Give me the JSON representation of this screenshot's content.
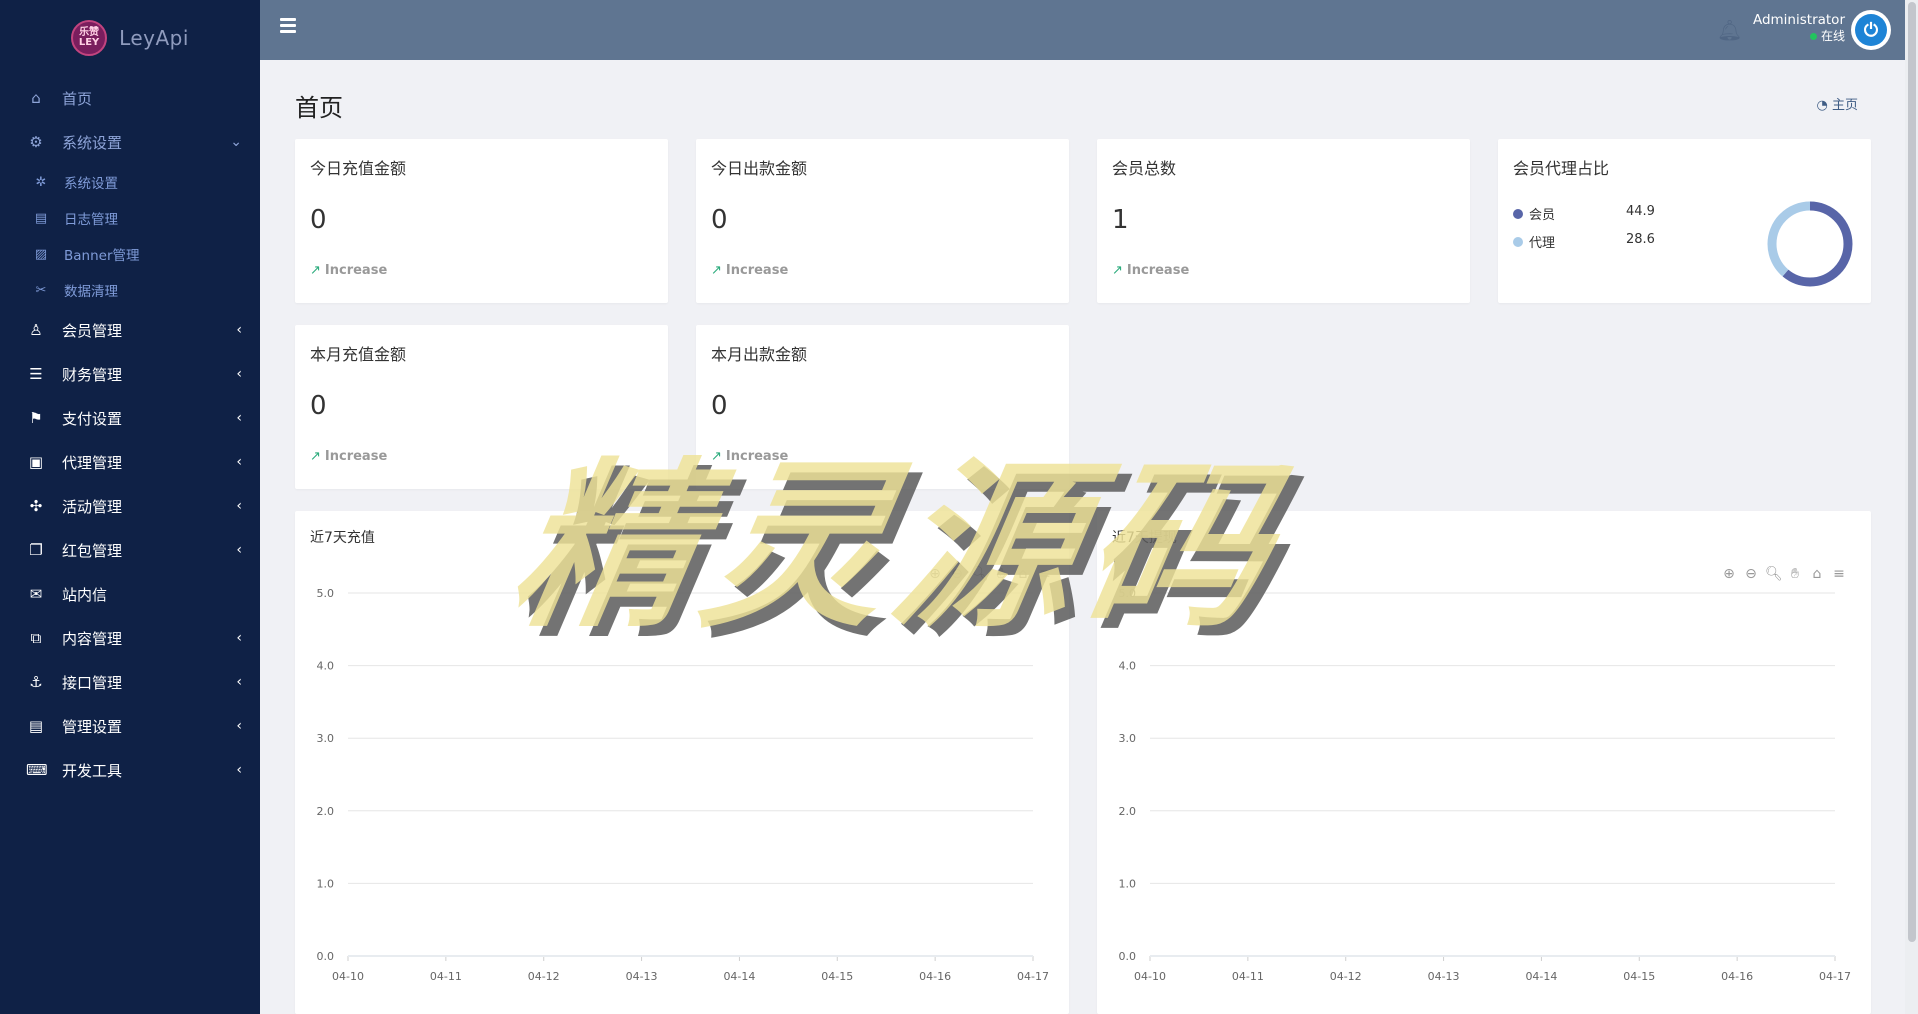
{
  "brand": {
    "logo_text": "乐赞LEY",
    "name": "LeyApi"
  },
  "header": {
    "user_name": "Administrator",
    "user_status": "在线"
  },
  "sidebar": {
    "items": [
      {
        "label": "首页",
        "icon": "home-icon"
      },
      {
        "label": "系统设置",
        "icon": "gears-icon",
        "expanded": true
      },
      {
        "label": "会员管理",
        "icon": "user-icon"
      },
      {
        "label": "财务管理",
        "icon": "database-icon"
      },
      {
        "label": "支付设置",
        "icon": "bookmark-icon"
      },
      {
        "label": "代理管理",
        "icon": "contact-icon"
      },
      {
        "label": "活动管理",
        "icon": "pinwheel-icon"
      },
      {
        "label": "红包管理",
        "icon": "clone-icon"
      },
      {
        "label": "站内信",
        "icon": "envelope-icon"
      },
      {
        "label": "内容管理",
        "icon": "copy-icon"
      },
      {
        "label": "接口管理",
        "icon": "anchor-icon"
      },
      {
        "label": "管理设置",
        "icon": "id-card-icon"
      },
      {
        "label": "开发工具",
        "icon": "keyboard-icon"
      }
    ],
    "sub_items": [
      {
        "label": "系统设置",
        "icon": "gear-icon"
      },
      {
        "label": "日志管理",
        "icon": "file-icon"
      },
      {
        "label": "Banner管理",
        "icon": "image-icon"
      },
      {
        "label": "数据清理",
        "icon": "scissors-icon"
      }
    ]
  },
  "page": {
    "title": "首页",
    "crumb": "主页"
  },
  "stats": [
    {
      "title": "今日充值金额",
      "value": "0",
      "trend": "Increase"
    },
    {
      "title": "今日出款金额",
      "value": "0",
      "trend": "Increase"
    },
    {
      "title": "会员总数",
      "value": "1",
      "trend": "Increase"
    },
    {
      "title": "本月充值金额",
      "value": "0",
      "trend": "Increase"
    },
    {
      "title": "本月出款金额",
      "value": "0",
      "trend": "Increase"
    }
  ],
  "ratio": {
    "title": "会员代理占比",
    "legend": [
      {
        "label": "会员",
        "value": "44.9",
        "color": "#5865a8"
      },
      {
        "label": "代理",
        "value": "28.6",
        "color": "#a9cbe8"
      }
    ]
  },
  "colors": {
    "sidebar_bg": "#0f2146",
    "header_bg": "#5f7591",
    "accent_green": "#2bab7c"
  },
  "watermark": "精灵源码",
  "chart_data": [
    {
      "type": "line",
      "title": "近7天充值",
      "categories": [
        "04-10",
        "04-11",
        "04-12",
        "04-13",
        "04-14",
        "04-15",
        "04-16",
        "04-17"
      ],
      "series": [
        {
          "values": [
            0,
            0,
            0,
            0,
            0,
            0,
            0,
            0
          ]
        }
      ],
      "ylim": [
        0,
        5
      ],
      "yticks": [
        "0.0",
        "1.0",
        "2.0",
        "3.0",
        "4.0",
        "5.0"
      ],
      "grid": true
    },
    {
      "type": "line",
      "title": "近7天提现",
      "categories": [
        "04-10",
        "04-11",
        "04-12",
        "04-13",
        "04-14",
        "04-15",
        "04-16",
        "04-17"
      ],
      "series": [
        {
          "values": [
            0,
            0,
            0,
            0,
            0,
            0,
            0,
            0
          ]
        }
      ],
      "ylim": [
        0,
        5
      ],
      "yticks": [
        "0.0",
        "1.0",
        "2.0",
        "3.0",
        "4.0",
        "5.0"
      ],
      "grid": true
    }
  ]
}
